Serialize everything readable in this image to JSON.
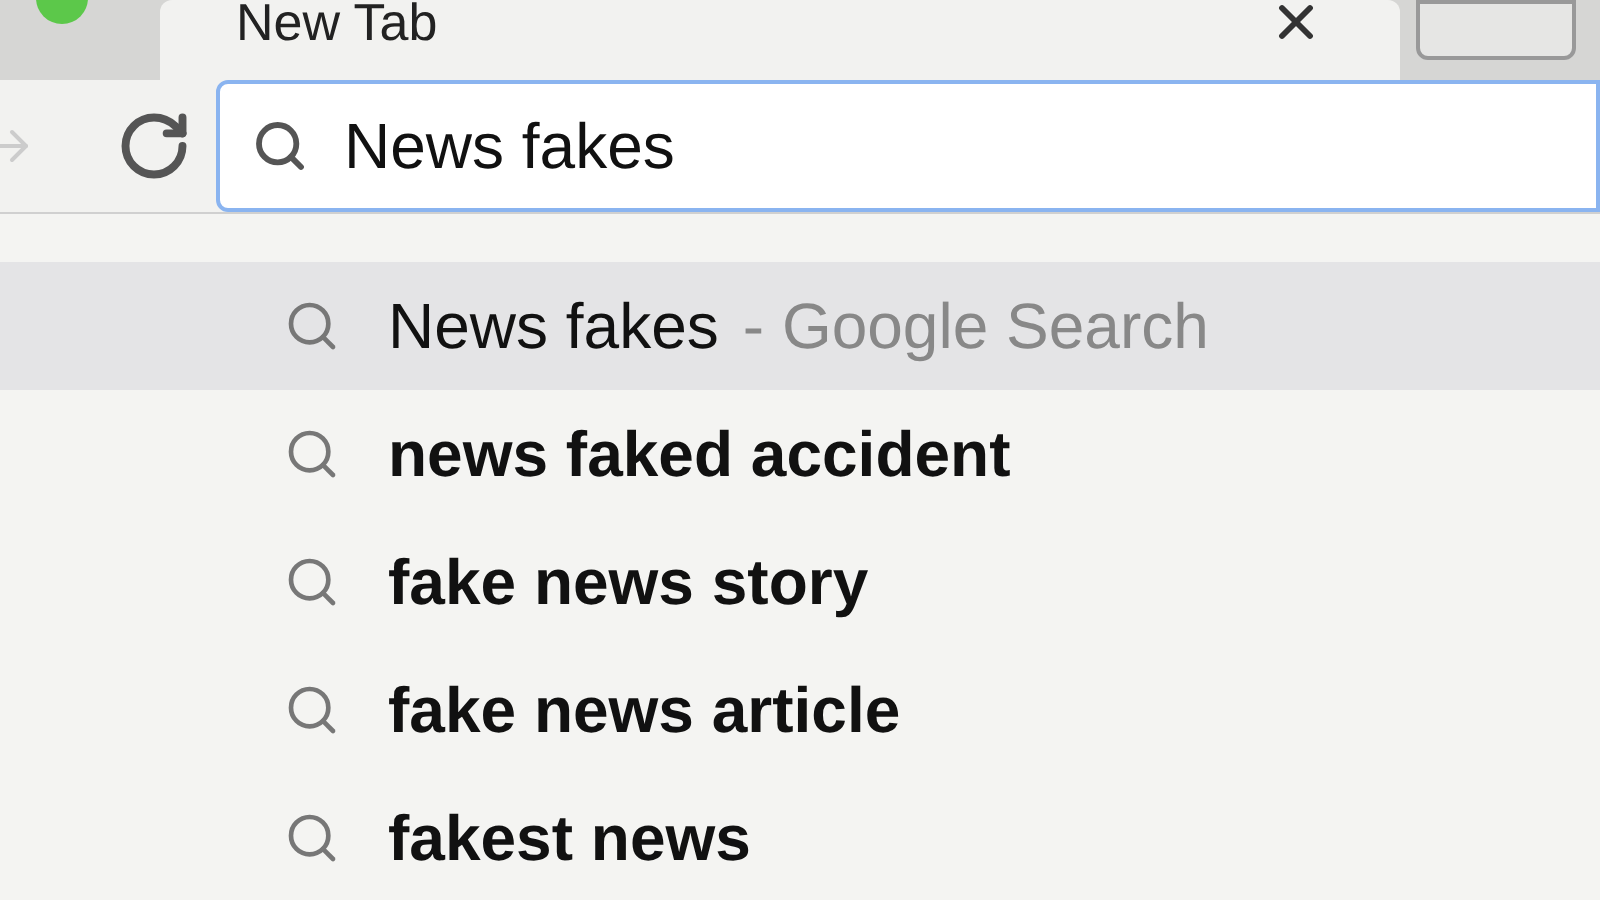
{
  "tab": {
    "title": "New Tab"
  },
  "omnibox": {
    "value": "News fakes"
  },
  "suggestions": [
    {
      "text": "News fakes",
      "hint": "- Google Search",
      "selected": true
    },
    {
      "text": "news faked accident",
      "selected": false
    },
    {
      "text": "fake news story",
      "selected": false
    },
    {
      "text": "fake news article",
      "selected": false
    },
    {
      "text": "fakest news",
      "selected": false
    }
  ]
}
